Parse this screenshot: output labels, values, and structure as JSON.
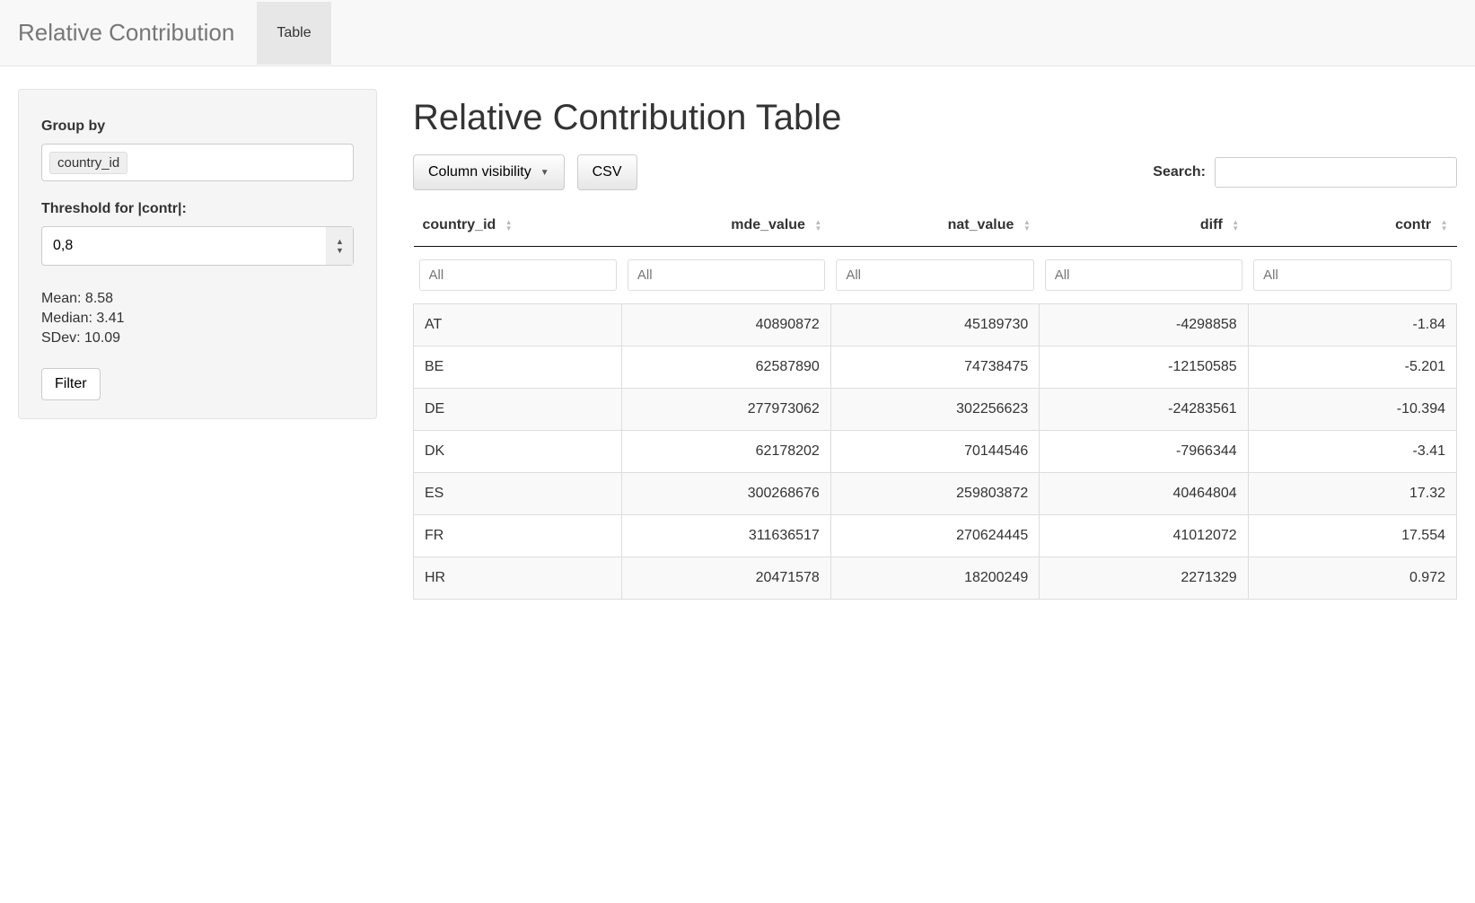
{
  "navbar": {
    "brand": "Relative Contribution",
    "tabs": [
      "Table"
    ],
    "active_tab": 0
  },
  "sidebar": {
    "group_by_label": "Group by",
    "group_by_tokens": [
      "country_id"
    ],
    "threshold_label": "Threshold for |contr|:",
    "threshold_value": "0,8",
    "stats": {
      "mean_label": "Mean:",
      "mean_value": "8.58",
      "median_label": "Median:",
      "median_value": "3.41",
      "sdev_label": "SDev:",
      "sdev_value": "10.09"
    },
    "filter_button": "Filter"
  },
  "main": {
    "heading": "Relative Contribution Table",
    "buttons": {
      "colvis": "Column visibility",
      "csv": "CSV"
    },
    "search_label": "Search:",
    "search_value": "",
    "columns": [
      {
        "key": "country_id",
        "label": "country_id",
        "type": "text"
      },
      {
        "key": "mde_value",
        "label": "mde_value",
        "type": "num"
      },
      {
        "key": "nat_value",
        "label": "nat_value",
        "type": "num"
      },
      {
        "key": "diff",
        "label": "diff",
        "type": "num"
      },
      {
        "key": "contr",
        "label": "contr",
        "type": "num"
      }
    ],
    "filter_placeholder": "All",
    "rows": [
      {
        "country_id": "AT",
        "mde_value": "40890872",
        "nat_value": "45189730",
        "diff": "-4298858",
        "contr": "-1.84"
      },
      {
        "country_id": "BE",
        "mde_value": "62587890",
        "nat_value": "74738475",
        "diff": "-12150585",
        "contr": "-5.201"
      },
      {
        "country_id": "DE",
        "mde_value": "277973062",
        "nat_value": "302256623",
        "diff": "-24283561",
        "contr": "-10.394"
      },
      {
        "country_id": "DK",
        "mde_value": "62178202",
        "nat_value": "70144546",
        "diff": "-7966344",
        "contr": "-3.41"
      },
      {
        "country_id": "ES",
        "mde_value": "300268676",
        "nat_value": "259803872",
        "diff": "40464804",
        "contr": "17.32"
      },
      {
        "country_id": "FR",
        "mde_value": "311636517",
        "nat_value": "270624445",
        "diff": "41012072",
        "contr": "17.554"
      },
      {
        "country_id": "HR",
        "mde_value": "20471578",
        "nat_value": "18200249",
        "diff": "2271329",
        "contr": "0.972"
      }
    ]
  }
}
